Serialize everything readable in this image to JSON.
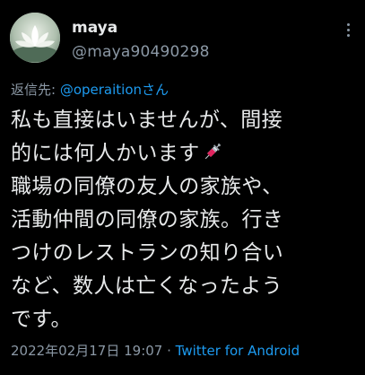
{
  "author": {
    "display_name": "maya",
    "handle": "@maya90490298",
    "avatar_icon": "lotus-flower-avatar"
  },
  "reply": {
    "prefix": "返信先: ",
    "mention": "@operaitionさん"
  },
  "body": {
    "lines": [
      "私も直接はいませんが、間接",
      "的には何人かいます",
      "職場の同僚の友人の家族や、",
      "活動仲間の同僚の家族。行き",
      "つけのレストランの知り合い",
      "など、数人は亡くなったよう",
      "です。"
    ],
    "emoji": "syringe-icon"
  },
  "meta": {
    "timestamp": "2022年02月17日 19:07",
    "separator": " · ",
    "source": "Twitter for Android"
  },
  "colors": {
    "background": "#000000",
    "primary_text": "#e7e9ea",
    "secondary_text": "#8b98a5",
    "link": "#1d9bf0"
  }
}
